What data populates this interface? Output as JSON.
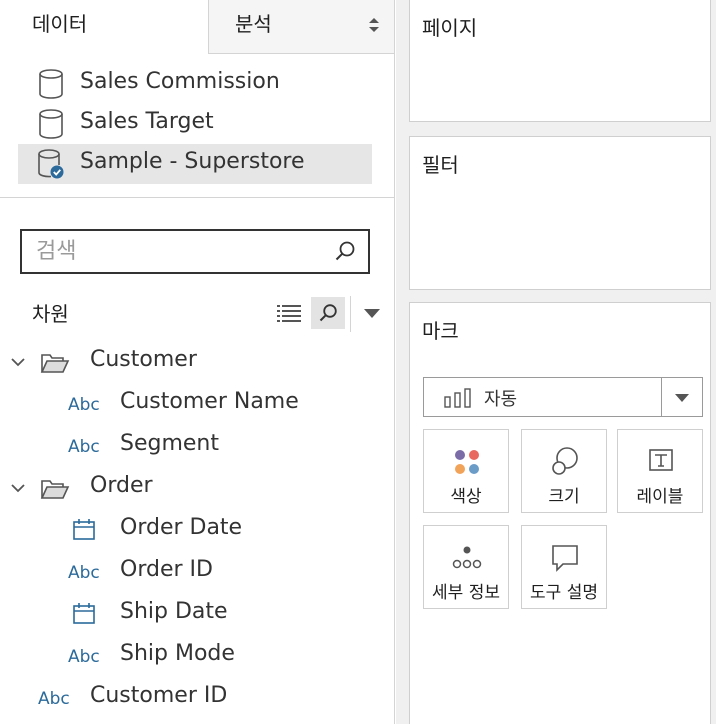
{
  "tabs": {
    "data": "데이터",
    "analysis": "분석"
  },
  "data_sources": [
    {
      "name": "Sales Commission",
      "selected": false
    },
    {
      "name": "Sales Target",
      "selected": false
    },
    {
      "name": "Sample - Superstore",
      "selected": true
    }
  ],
  "search": {
    "placeholder": "검색",
    "value": ""
  },
  "dimensions": {
    "title": "차원",
    "items": [
      {
        "kind": "folder",
        "label": "Customer"
      },
      {
        "kind": "field",
        "type_label": "Abc",
        "label": "Customer Name"
      },
      {
        "kind": "field",
        "type_label": "Abc",
        "label": "Segment"
      },
      {
        "kind": "folder",
        "label": "Order"
      },
      {
        "kind": "date",
        "label": "Order Date"
      },
      {
        "kind": "field",
        "type_label": "Abc",
        "label": "Order ID"
      },
      {
        "kind": "date",
        "label": "Ship Date"
      },
      {
        "kind": "field",
        "type_label": "Abc",
        "label": "Ship Mode"
      },
      {
        "kind": "field",
        "type_label": "Abc",
        "label": "Customer ID"
      }
    ]
  },
  "shelves": {
    "pages": "페이지",
    "filters": "필터",
    "marks": "마크"
  },
  "marks": {
    "type": "자동",
    "buttons": [
      {
        "label": "색상",
        "icon": "color-dots-icon"
      },
      {
        "label": "크기",
        "icon": "size-circles-icon"
      },
      {
        "label": "레이블",
        "icon": "text-label-icon"
      },
      {
        "label": "세부 정보",
        "icon": "detail-dots-icon"
      },
      {
        "label": "도구 설명",
        "icon": "tooltip-bubble-icon"
      }
    ]
  },
  "colors": {
    "accent_blue": "#2b6a9a",
    "dot_purple": "#7b6ca8",
    "dot_red": "#e8685f",
    "dot_orange": "#f2a35a",
    "dot_blue": "#6b9bc7"
  }
}
